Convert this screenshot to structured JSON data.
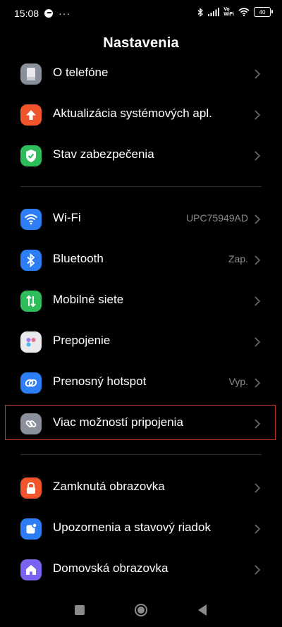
{
  "status_bar": {
    "time": "15:08",
    "more": "···",
    "vowifi_top": "Vo",
    "vowifi_bottom": "WiFi",
    "battery": "40"
  },
  "page": {
    "title": "Nastavenia"
  },
  "groups": [
    {
      "items": [
        {
          "label": "O telefóne",
          "value": "",
          "icon": "phone-icon",
          "color": "#8a8f9c"
        },
        {
          "label": "Aktualizácia systémových apl.",
          "value": "",
          "icon": "arrow-up-icon",
          "color": "#f0552c"
        },
        {
          "label": "Stav zabezpečenia",
          "value": "",
          "icon": "shield-check-icon",
          "color": "#2fbd5b"
        }
      ]
    },
    {
      "items": [
        {
          "label": "Wi-Fi",
          "value": "UPC75949AD",
          "icon": "wifi-icon",
          "color": "#2d7ef5"
        },
        {
          "label": "Bluetooth",
          "value": "Zap.",
          "icon": "bluetooth-icon",
          "color": "#2d7ef5"
        },
        {
          "label": "Mobilné siete",
          "value": "",
          "icon": "mobile-data-icon",
          "color": "#2fbd5b"
        },
        {
          "label": "Prepojenie",
          "value": "",
          "icon": "connect-dots-icon",
          "color": "#e9e9ee"
        },
        {
          "label": "Prenosný hotspot",
          "value": "Vyp.",
          "icon": "hotspot-icon",
          "color": "#2d7ef5"
        },
        {
          "label": "Viac možností pripojenia",
          "value": "",
          "icon": "link-icon",
          "color": "#8a8f9c"
        }
      ]
    },
    {
      "items": [
        {
          "label": "Zamknutá obrazovka",
          "value": "",
          "icon": "lock-icon",
          "color": "#f0552c"
        },
        {
          "label": "Upozornenia a stavový riadok",
          "value": "",
          "icon": "notification-icon",
          "color": "#2d7ef5"
        },
        {
          "label": "Domovská obrazovka",
          "value": "",
          "icon": "home-icon",
          "color": "#7b63f2"
        }
      ]
    }
  ],
  "nav": {
    "recents": "recents-icon",
    "home": "home-button-icon",
    "back": "back-icon"
  }
}
